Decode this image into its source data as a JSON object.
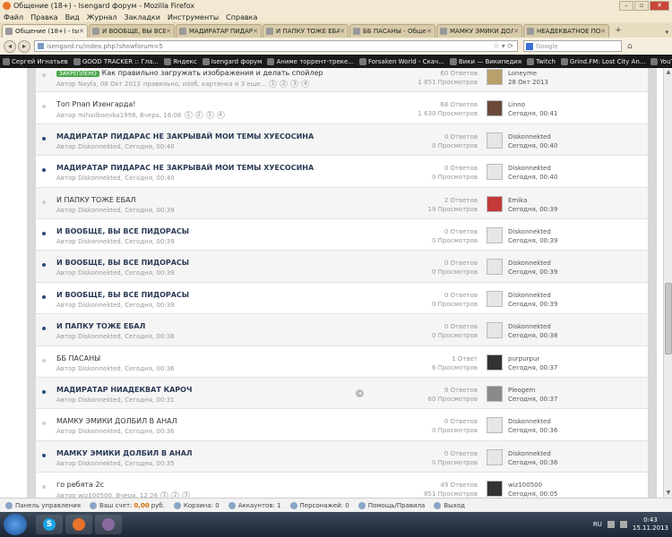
{
  "window": {
    "title": "Общение (18+) - Isengard форум - Mozilla Firefox",
    "controls": [
      "–",
      "▫",
      "✕"
    ]
  },
  "menu": [
    "Файл",
    "Правка",
    "Вид",
    "Журнал",
    "Закладки",
    "Инструменты",
    "Справка"
  ],
  "tabs": [
    {
      "label": "Общение (18+) - Isen...",
      "active": true
    },
    {
      "label": "И ВООБЩЕ, ВЫ ВСЕ П...",
      "active": false
    },
    {
      "label": "МАДИРАТАР ПИДАРАС...",
      "active": false
    },
    {
      "label": "И ПАПКУ ТОЖЕ ЕБАЛ ...",
      "active": false
    },
    {
      "label": "ББ ПАСАНЫ - Общени...",
      "active": false
    },
    {
      "label": "МАМКУ ЭМИКИ ДОЛБ...",
      "active": false
    },
    {
      "label": "НЕАДЕКВАТНОЕ ПОВЕ...",
      "active": false
    }
  ],
  "navbar": {
    "url": "isengard.ru/index.php?showforum=5",
    "search_placeholder": "Google"
  },
  "bookmarks": [
    "Сергей Игнатьев",
    "GOOD TRACKER :: Гла...",
    "Яндекс",
    "Isengard форум",
    "Аниме торрент-треке...",
    "Forsaken World - Скач...",
    "Вики — Википедия",
    "Twitch",
    "Grind.FM: Lost City An...",
    "YouTube"
  ],
  "topics": [
    {
      "title": "Как правильно загружать изображения и делать спойлер",
      "pinned_label": "ЗАКРЕПЛЕНО",
      "meta": "Автор Nayfa, 08 Окт 2013",
      "tags": "правильно, изоб, картинка и 3 еще...",
      "pages": [
        "1",
        "2",
        "3",
        "4"
      ],
      "answers": "60 Ответов",
      "views": "1 851 Просмотров",
      "last_user": "Loneyme",
      "last_date": "28 Окт 2013",
      "bold": false,
      "read": true,
      "alt": true
    },
    {
      "title": "Топ Рпап Изенгарда!",
      "meta": "Автор mihailbaevka1998, Вчера, 16:06",
      "pages": [
        "1",
        "2",
        "3",
        "4"
      ],
      "answers": "68 Ответов",
      "views": "1 630 Просмотров",
      "last_user": "Linno",
      "last_date": "Сегодня, 00:41",
      "bold": false,
      "read": true,
      "alt": false
    },
    {
      "title": "МАДИРАТАР ПИДАРАС НЕ ЗАКРЫВАЙ МОИ ТЕМЫ ХУЕСОСИНА",
      "meta": "Автор Diskonnekted, Сегодня, 00:40",
      "answers": "0 Ответов",
      "views": "0 Просмотров",
      "last_user": "Diskonnekted",
      "last_date": "Сегодня, 00:40",
      "bold": true,
      "read": false,
      "alt": true
    },
    {
      "title": "МАДИРАТАР ПИДАРАС НЕ ЗАКРЫВАЙ МОИ ТЕМЫ ХУЕСОСИНА",
      "meta": "Автор Diskonnekted, Сегодня, 00:40",
      "answers": "0 Ответов",
      "views": "0 Просмотров",
      "last_user": "Diskonnekted",
      "last_date": "Сегодня, 00:40",
      "bold": true,
      "read": false,
      "alt": false
    },
    {
      "title": "И ПАПКУ ТОЖЕ ЕБАЛ",
      "meta": "Автор Diskonnekted, Сегодня, 00:39",
      "answers": "2 Ответов",
      "views": "19 Просмотров",
      "last_user": "Emika",
      "last_date": "Сегодня, 00:39",
      "bold": false,
      "read": true,
      "alt": true
    },
    {
      "title": "И ВООБЩЕ, ВЫ ВСЕ ПИДОРАСЫ",
      "meta": "Автор Diskonnekted, Сегодня, 00:39",
      "answers": "0 Ответов",
      "views": "0 Просмотров",
      "last_user": "Diskonnekted",
      "last_date": "Сегодня, 00:39",
      "bold": true,
      "read": false,
      "alt": false
    },
    {
      "title": "И ВООБЩЕ, ВЫ ВСЕ ПИДОРАСЫ",
      "meta": "Автор Diskonnekted, Сегодня, 00:39",
      "answers": "0 Ответов",
      "views": "0 Просмотров",
      "last_user": "Diskonnekted",
      "last_date": "Сегодня, 00:39",
      "bold": true,
      "read": false,
      "alt": true
    },
    {
      "title": "И ВООБЩЕ, ВЫ ВСЕ ПИДОРАСЫ",
      "meta": "Автор Diskonnekted, Сегодня, 00:39",
      "answers": "0 Ответов",
      "views": "0 Просмотров",
      "last_user": "Diskonnekted",
      "last_date": "Сегодня, 00:39",
      "bold": true,
      "read": false,
      "alt": false
    },
    {
      "title": "И ПАПКУ ТОЖЕ ЕБАЛ",
      "meta": "Автор Diskonnekted, Сегодня, 00:38",
      "answers": "0 Ответов",
      "views": "0 Просмотров",
      "last_user": "Diskonnekted",
      "last_date": "Сегодня, 00:38",
      "bold": true,
      "read": false,
      "alt": true
    },
    {
      "title": "ББ ПАСАНЫ",
      "meta": "Автор Diskonnekted, Сегодня, 00:36",
      "answers": "1 Ответ",
      "views": "6 Просмотров",
      "last_user": "purpurpur",
      "last_date": "Сегодня, 00:37",
      "bold": false,
      "read": true,
      "alt": false
    },
    {
      "title": "МАДИРАТАР НИАДЕКВАТ КАРОЧ",
      "meta": "Автор Diskonnekted, Сегодня, 00:31",
      "answers": "9 Ответов",
      "views": "60 Просмотров",
      "last_user": "Pleogem",
      "last_date": "Сегодня, 00:37",
      "bold": true,
      "read": false,
      "alt": true
    },
    {
      "title": "МАМКУ ЭМИКИ ДОЛБИЛ В АНАЛ",
      "meta": "Автор Diskonnekted, Сегодня, 00:36",
      "answers": "0 Ответов",
      "views": "0 Просмотров",
      "last_user": "Diskonnekted",
      "last_date": "Сегодня, 00:36",
      "bold": false,
      "read": true,
      "alt": false
    },
    {
      "title": "МАМКУ ЭМИКИ ДОЛБИЛ В АНАЛ",
      "meta": "Автор Diskonnekted, Сегодня, 00:35",
      "answers": "0 Ответов",
      "views": "0 Просмотров",
      "last_user": "Diskonnekted",
      "last_date": "Сегодня, 00:36",
      "bold": true,
      "read": false,
      "alt": true
    },
    {
      "title": "го ребята 2с",
      "meta": "Автор wiz100500, Вчера, 12:26",
      "pages": [
        "1",
        "2",
        "3"
      ],
      "answers": "49 Ответов",
      "views": "851 Просмотров",
      "last_user": "wiz100500",
      "last_date": "Сегодня, 00:05",
      "bold": false,
      "read": true,
      "alt": false
    }
  ],
  "addonbar": {
    "panel": "Панель управления",
    "account_label": "Ваш счет:",
    "account_value": "0,00",
    "account_unit": "руб.",
    "cart": "Корзина: 0",
    "accounts": "Аккаунтов: 1",
    "characters": "Персонажей: 0",
    "help": "Помощь/Правила",
    "exit": "Выход"
  },
  "taskbar": {
    "lang": "RU",
    "time": "0:43",
    "date": "15.11.2013"
  },
  "colors": {
    "unread_dot": "#2b4a7a",
    "read_dot": "#cfcfcf",
    "pinned_badge": "#4aa84a",
    "money": "#d46a00"
  }
}
